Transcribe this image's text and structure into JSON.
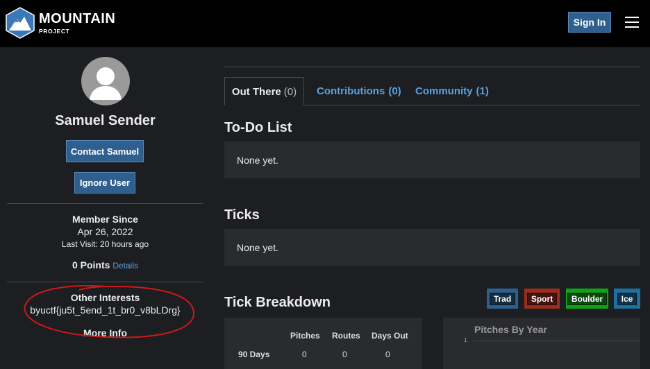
{
  "brand": {
    "name": "MOUNTAIN",
    "sub": "PROJECT"
  },
  "header": {
    "signin_label": "Sign In"
  },
  "profile": {
    "name": "Samuel Sender",
    "contact_label": "Contact Samuel",
    "ignore_label": "Ignore User",
    "member_since_label": "Member Since",
    "member_since_date": "Apr 26, 2022",
    "last_visit": "Last Visit: 20 hours ago",
    "points": "0 Points",
    "details_label": "Details",
    "other_interests_label": "Other Interests",
    "other_interests_value": "byuctf{ju5t_5end_1t_br0_v8bLDrg}",
    "more_info_label": "More Info"
  },
  "tabs": [
    {
      "label": "Out There",
      "count": "(0)"
    },
    {
      "label": "Contributions",
      "count": "(0)"
    },
    {
      "label": "Community",
      "count": "(1)"
    }
  ],
  "todo": {
    "title": "To-Do List",
    "empty": "None yet."
  },
  "ticks": {
    "title": "Ticks",
    "empty": "None yet."
  },
  "breakdown": {
    "title": "Tick Breakdown",
    "filters": [
      "Trad",
      "Sport",
      "Boulder",
      "Ice"
    ],
    "columns": [
      "Pitches",
      "Routes",
      "Days Out"
    ],
    "rows": [
      {
        "label": "90 Days",
        "values": [
          "0",
          "0",
          "0"
        ]
      }
    ]
  },
  "chart": {
    "title": "Pitches By Year",
    "ytick": "1"
  },
  "colors": {
    "nav_bg": "#000000",
    "page_bg": "#1d1e21",
    "panel_bg": "#2a2b2f",
    "button_blue": "#2f5f8f",
    "link_blue": "#5aa2e0",
    "annotation_red": "#d01818"
  }
}
